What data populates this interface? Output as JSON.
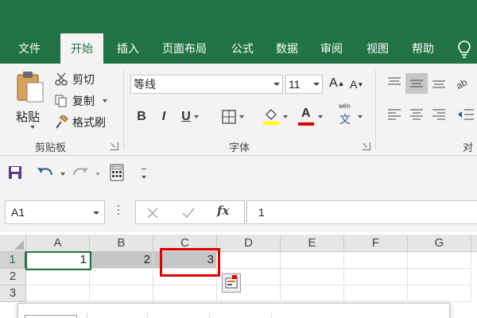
{
  "ribbon_tabs": [
    {
      "label": "文件",
      "active": false
    },
    {
      "label": "开始",
      "active": true
    },
    {
      "label": "插入",
      "active": false
    },
    {
      "label": "页面布局",
      "active": false
    },
    {
      "label": "公式",
      "active": false
    },
    {
      "label": "数据",
      "active": false
    },
    {
      "label": "审阅",
      "active": false
    },
    {
      "label": "视图",
      "active": false
    },
    {
      "label": "帮助",
      "active": false
    }
  ],
  "clipboard": {
    "paste_label": "粘贴",
    "cut_label": "剪切",
    "copy_label": "复制",
    "format_painter_label": "格式刷",
    "group_label": "剪贴板"
  },
  "font": {
    "font_name": "等线",
    "font_size": "11",
    "bold": "B",
    "italic": "I",
    "underline": "U",
    "font_color_glyph": "A",
    "wen_glyph": "文",
    "wen_pinyin": "wén",
    "group_label": "字体",
    "grow_font": "A",
    "shrink_font": "A"
  },
  "alignment": {
    "group_label": "对齐"
  },
  "formula_bar": {
    "name_box": "A1",
    "fx_label": "fx",
    "formula_value": "1"
  },
  "sheet": {
    "columns": [
      "A",
      "B",
      "C",
      "D",
      "E",
      "F",
      "G"
    ],
    "rows": [
      "1",
      "2",
      "3"
    ],
    "row1_values": {
      "A": "1",
      "B": "2",
      "C": "3"
    }
  },
  "colors": {
    "excel_green": "#217346",
    "highlight_yellow": "#ffff00",
    "font_red": "#e00000",
    "annotation_red": "#e00000"
  }
}
